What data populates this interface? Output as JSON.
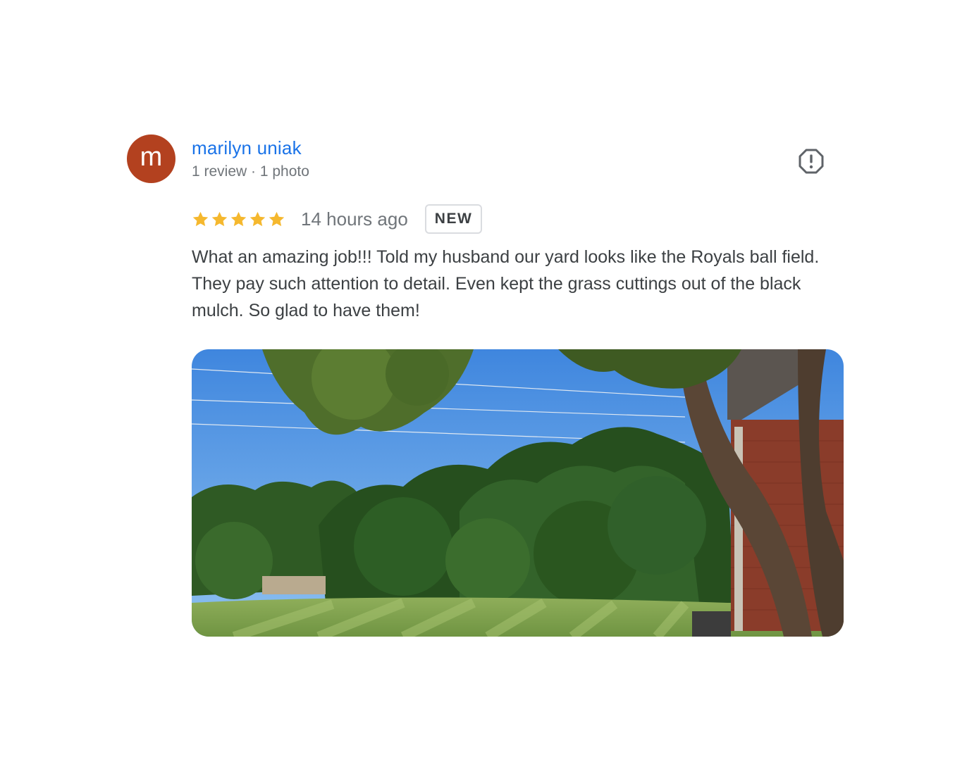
{
  "author": {
    "initial": "m",
    "name": "marilyn uniak",
    "meta": "1 review · 1 photo",
    "avatar_color": "#b3411f"
  },
  "report_icon": "report-flag-icon",
  "rating": {
    "stars": 5,
    "max": 5,
    "star_color": "#f5b82e",
    "time": "14 hours ago",
    "badge": "NEW"
  },
  "review": {
    "text": "What an amazing job!!! Told my husband our yard looks like the Royals ball field. They pay such attention to detail. Even kept the grass cuttings out of the black mulch. So glad to have them!"
  },
  "photo": {
    "subject": "backyard-lawn-photo"
  }
}
